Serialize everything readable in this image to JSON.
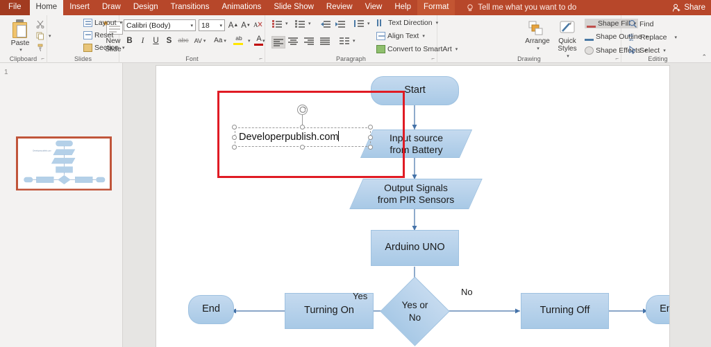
{
  "tabs": {
    "items": [
      {
        "label": "File",
        "state": "file"
      },
      {
        "label": "Home",
        "state": "active"
      },
      {
        "label": "Insert",
        "state": "normal"
      },
      {
        "label": "Draw",
        "state": "normal"
      },
      {
        "label": "Design",
        "state": "normal"
      },
      {
        "label": "Transitions",
        "state": "normal"
      },
      {
        "label": "Animations",
        "state": "normal"
      },
      {
        "label": "Slide Show",
        "state": "normal"
      },
      {
        "label": "Review",
        "state": "normal"
      },
      {
        "label": "View",
        "state": "normal"
      },
      {
        "label": "Help",
        "state": "normal"
      },
      {
        "label": "Format",
        "state": "contextual"
      }
    ],
    "tell_me": "Tell me what you want to do",
    "share": "Share",
    "accent_color": "#b7472a",
    "file_color": "#a23b20",
    "contextual_color": "#c35532"
  },
  "ribbon": {
    "groups": [
      {
        "label": "Clipboard",
        "has_dialog_launcher": true
      },
      {
        "label": "Slides",
        "has_dialog_launcher": false
      },
      {
        "label": "Font",
        "has_dialog_launcher": true
      },
      {
        "label": "Paragraph",
        "has_dialog_launcher": true
      },
      {
        "label": "Drawing",
        "has_dialog_launcher": true
      },
      {
        "label": "Editing",
        "has_dialog_launcher": false
      }
    ],
    "clipboard": {
      "paste_label": "Paste",
      "cut_icon": "scissors-icon",
      "copy_icon": "copy-icon",
      "format_painter_icon": "format-painter-icon"
    },
    "slides": {
      "new_slide_label": "New Slide",
      "layout_label": "Layout",
      "reset_label": "Reset",
      "section_label": "Section"
    },
    "font": {
      "font_name": "Calibri (Body)",
      "font_size": "18",
      "grow_font": "A",
      "shrink_font": "A",
      "clear_formatting_icon": "clear-formatting-icon",
      "bold": "B",
      "italic": "I",
      "underline": "U",
      "shadow": "S",
      "strikethrough": "abc",
      "character_spacing": "AV",
      "change_case": "Aa",
      "highlight": "ab",
      "font_color": "A",
      "highlight_color": "#ffe600",
      "font_color_swatch": "#c00000"
    },
    "paragraph": {
      "bullets_icon": "bullets-icon",
      "numbering_icon": "numbering-icon",
      "decrease_indent_icon": "decrease-indent-icon",
      "increase_indent_icon": "increase-indent-icon",
      "line_spacing_icon": "line-spacing-icon",
      "align_left_icon": "align-left-icon",
      "align_center_icon": "align-center-icon",
      "align_right_icon": "align-right-icon",
      "justify_icon": "justify-icon",
      "columns_icon": "columns-icon",
      "text_direction_label": "Text Direction",
      "align_text_label": "Align Text",
      "convert_smartart_label": "Convert to SmartArt"
    },
    "drawing": {
      "shapes_gallery": [
        "textbox",
        "line",
        "arrow-line",
        "rectangle",
        "oval",
        "rounded-rectangle",
        "triangle",
        "elbow-connector",
        "elbow-arrow",
        "right-arrow",
        "down-arrow",
        "pentagon",
        "freeform",
        "arc",
        "curve",
        "left-brace",
        "right-brace",
        "star"
      ],
      "arrange_label": "Arrange",
      "quick_styles_label": "Quick Styles",
      "shape_fill_label": "Shape Fill",
      "shape_outline_label": "Shape Outline",
      "shape_effects_label": "Shape Effects"
    },
    "editing": {
      "find_label": "Find",
      "replace_label": "Replace",
      "select_label": "Select",
      "collapse_ribbon_icon": "chevron-up-icon"
    }
  },
  "slide_panel": {
    "slide_number": "1",
    "selected": true,
    "selection_color": "#c0553a"
  },
  "canvas": {
    "textbox": {
      "value": "Developerpublish.com",
      "font_size": "18",
      "selected": true,
      "has_cursor": true
    },
    "highlight_rect": {
      "color": "#e01b24",
      "visible": true
    },
    "flowchart": {
      "shape_fill_top": "#c5daef",
      "shape_fill_bottom": "#a8c9e6",
      "shape_outline": "#9ec1e0",
      "connector_color": "#4472a8",
      "nodes": [
        {
          "id": "start",
          "label": "Start",
          "type": "terminator"
        },
        {
          "id": "input",
          "label": "Input source\nfrom Battery",
          "type": "parallelogram"
        },
        {
          "id": "output",
          "label": "Output Signals\nfrom PIR Sensors",
          "type": "parallelogram"
        },
        {
          "id": "arduino",
          "label": "Arduino UNO",
          "type": "process"
        },
        {
          "id": "decision",
          "label": "Yes or\nNo",
          "type": "decision"
        },
        {
          "id": "turning_on",
          "label": "Turning On",
          "type": "process"
        },
        {
          "id": "turning_off",
          "label": "Turning Off",
          "type": "process"
        },
        {
          "id": "end_left",
          "label": "End",
          "type": "terminator"
        },
        {
          "id": "end_right",
          "label": "End",
          "type": "terminator"
        }
      ],
      "edge_labels": [
        {
          "id": "yes",
          "label": "Yes"
        },
        {
          "id": "no",
          "label": "No"
        }
      ]
    }
  }
}
